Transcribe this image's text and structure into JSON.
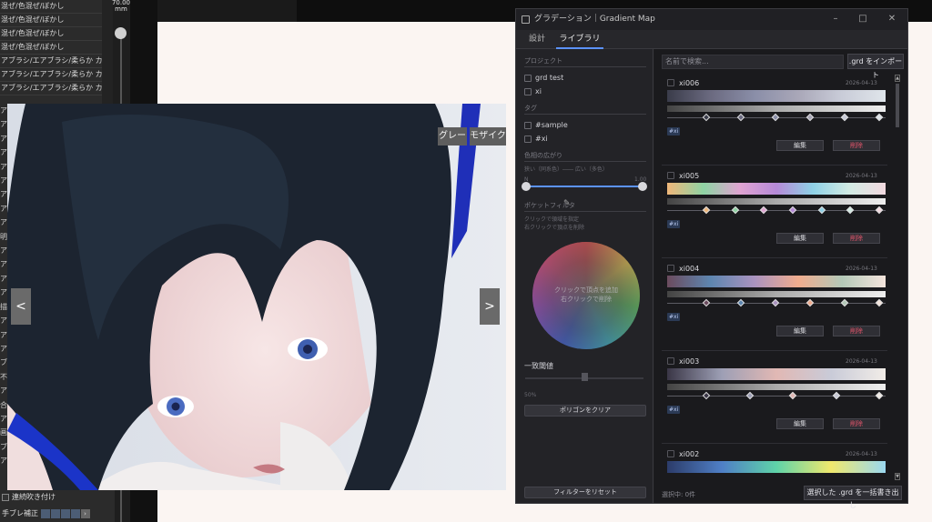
{
  "brush_list": {
    "items": [
      "混ぜ/色混ぜ/ぼかし",
      "混ぜ/色混ぜ/ぼかし",
      "混ぜ/色混ぜ/ぼかし",
      "混ぜ/色混ぜ/ぼかし",
      "アブラシ/エアブラシ/柔らか カスタム",
      "アブラシ/エアブラシ/柔らか カスタム",
      "アブラシ/エアブラシ/柔らか カスタム"
    ],
    "size_value": "70.00",
    "size_unit": "mm",
    "edge_labels": [
      "ア",
      "ア",
      "ア",
      "ア",
      "ア",
      "ア",
      "ア",
      "ア",
      "ア",
      "明",
      "ア",
      "ア",
      "ア",
      "ア",
      "描",
      "ア",
      "ア",
      "ア",
      "ブ",
      "不",
      "ア",
      "合",
      "ア",
      "画",
      "ブ",
      "ア"
    ]
  },
  "bottom_left": {
    "continuous_label": "連続吹き付け",
    "stabilizer_label": "手ブレ補正"
  },
  "preview": {
    "gray_button": "グレー",
    "mosaic_button": "モザイク",
    "prev_button": "<",
    "next_button": ">"
  },
  "gm_window": {
    "title": "グラデーション｜Gradient Map",
    "tabs": [
      "設計",
      "ライブラリ"
    ],
    "active_tab": "ライブラリ",
    "left": {
      "project_label": "プロジェクト",
      "projects": [
        "grd test",
        "xi"
      ],
      "tag_label": "タグ",
      "tags": [
        "#sample",
        "#xi"
      ],
      "hue_spread_label": "色相の広がり",
      "hue_range_text": "狭い（同系色）―― 広い（多色）",
      "hue_min": "N",
      "hue_max": "1.00",
      "preset_filter_label": "ポケットフィルタ",
      "hint_line1": "クリックで領域を指定",
      "hint_line2": "右クリックで頂点を削除",
      "wheel_hint1": "クリックで頂点を追加",
      "wheel_hint2": "右クリックで削除",
      "threshold_label": "一致閾値",
      "threshold_value": "50%",
      "threshold_fraction": 0.5,
      "clear_polygon_button": "ポリゴンをクリア",
      "reset_filter_button": "フィルターをリセット"
    },
    "right": {
      "search_placeholder": "名前で検索...",
      "import_button": ".grd をインポート",
      "selected_count": "選択中: 0件",
      "bulk_export_button": "選択した .grd を一括書き出し",
      "edit_label": "編集",
      "delete_label": "削除",
      "items": [
        {
          "name": "xi006",
          "date": "2026-04-13",
          "tag": "#xi",
          "colors": [
            "#3a3c4a",
            "#6b6a80",
            "#8a8ea8",
            "#a9a7b8",
            "#c9ccd8",
            "#dfe5ea"
          ]
        },
        {
          "name": "xi005",
          "date": "2026-04-13",
          "tag": "#xi",
          "colors": [
            "#f0b77a",
            "#8fd4a4",
            "#e0a4d2",
            "#b68ad8",
            "#8fd1e6",
            "#d2ebe4",
            "#f2d9e0"
          ]
        },
        {
          "name": "xi004",
          "date": "2026-04-13",
          "tag": "#xi",
          "colors": [
            "#6b4b5e",
            "#5e86b0",
            "#aa93bf",
            "#f0ac8e",
            "#b4c9b8",
            "#f4e4dc"
          ]
        },
        {
          "name": "xi003",
          "date": "2026-04-13",
          "tag": "#xi",
          "colors": [
            "#3a3646",
            "#9d9fb5",
            "#e1b8b4",
            "#c9cbd8",
            "#f1ece7"
          ]
        },
        {
          "name": "xi002",
          "date": "2026-04-13",
          "tag": "",
          "colors": [
            "#2c3c6a",
            "#4f7fc6",
            "#5fd3a9",
            "#f0e86d",
            "#9ad8f0"
          ]
        }
      ]
    }
  }
}
